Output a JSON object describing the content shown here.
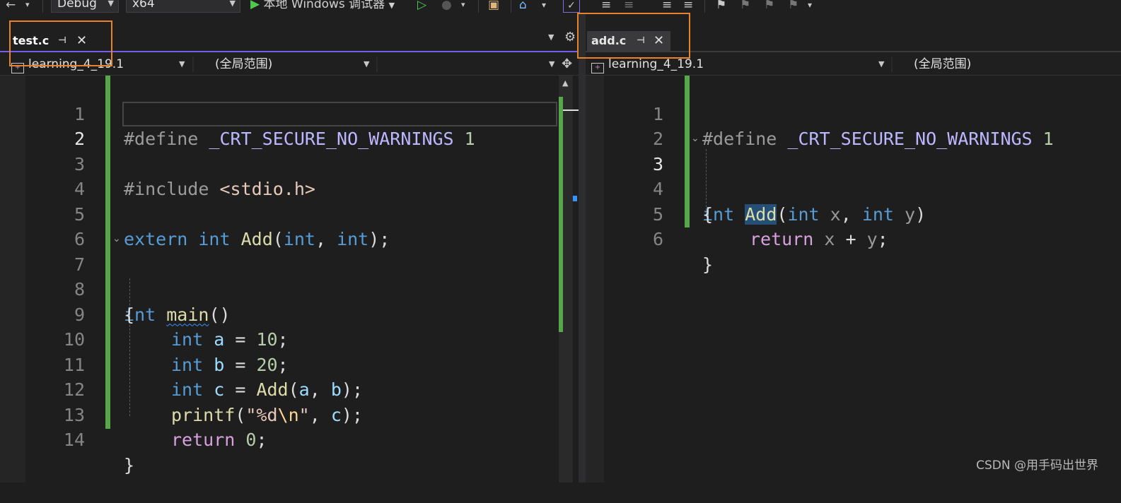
{
  "toolbar": {
    "config": "Debug",
    "platform": "x64",
    "run_label": "本地 Windows 调试器"
  },
  "left_pane": {
    "tab_name": "test.c",
    "project": "learning_4_19.1",
    "scope": "(全局范围)",
    "lines": [
      {
        "n": "1"
      },
      {
        "n": "2"
      },
      {
        "n": "3"
      },
      {
        "n": "4"
      },
      {
        "n": "5"
      },
      {
        "n": "6"
      },
      {
        "n": "7"
      },
      {
        "n": "8"
      },
      {
        "n": "9"
      },
      {
        "n": "10"
      },
      {
        "n": "11"
      },
      {
        "n": "12"
      },
      {
        "n": "13"
      },
      {
        "n": "14"
      }
    ],
    "code": {
      "l1_directive": "#define",
      "l1_macro": "_CRT_SECURE_NO_WARNINGS",
      "l1_value": "1",
      "l3_directive": "#include",
      "l3_header": "<stdio.h>",
      "l5_extern": "extern",
      "l5_int1": "int",
      "l5_fn": "Add",
      "l5_p1": "(",
      "l5_int2": "int",
      "l5_comma": ", ",
      "l5_int3": "int",
      "l5_end": ");",
      "l7_int": "int",
      "l7_fn": "main",
      "l7_parens": "()",
      "l8_brace": "{",
      "l9_int": "int",
      "l9_var": "a",
      "l9_eq": " = ",
      "l9_num": "10",
      "l9_semi": ";",
      "l10_int": "int",
      "l10_var": "b",
      "l10_eq": " = ",
      "l10_num": "20",
      "l10_semi": ";",
      "l11_int": "int",
      "l11_var": "c",
      "l11_eq": " = ",
      "l11_fn": "Add",
      "l11_p": "(",
      "l11_a": "a",
      "l11_comma": ", ",
      "l11_b": "b",
      "l11_end": ");",
      "l12_fn": "printf",
      "l12_p": "(",
      "l12_str1": "\"%d",
      "l12_esc": "\\n",
      "l12_str2": "\"",
      "l12_comma": ", ",
      "l12_c": "c",
      "l12_end": ");",
      "l13_return": "return",
      "l13_num": "0",
      "l13_semi": ";",
      "l14_brace": "}"
    }
  },
  "right_pane": {
    "tab_name": "add.c",
    "project": "learning_4_19.1",
    "scope": "(全局范围)",
    "lines": [
      {
        "n": "1"
      },
      {
        "n": "2"
      },
      {
        "n": "3"
      },
      {
        "n": "4"
      },
      {
        "n": "5"
      },
      {
        "n": "6"
      }
    ],
    "code": {
      "l1_directive": "#define",
      "l1_macro": "_CRT_SECURE_NO_WARNINGS",
      "l1_value": "1",
      "l3_int1": "int",
      "l3_fn": "Add",
      "l3_p": "(",
      "l3_int2": "int",
      "l3_x": "x",
      "l3_comma": ", ",
      "l3_int3": "int",
      "l3_y": "y",
      "l3_end": ")",
      "l4_brace": "{",
      "l5_return": "return",
      "l5_x": "x",
      "l5_plus": " + ",
      "l5_y": "y",
      "l5_semi": ";",
      "l6_brace": "}"
    }
  },
  "watermark": "CSDN @用手码出世界",
  "colors": {
    "highlight_box": "#e8822b",
    "change_bar": "#57a64a",
    "keyword": "#569cd6",
    "function": "#dcdcaa",
    "macro": "#beb7ff"
  }
}
